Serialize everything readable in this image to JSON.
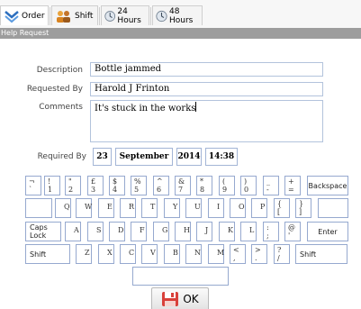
{
  "tabs": [
    {
      "label": "Order",
      "icon": "order-icon",
      "active": true
    },
    {
      "label": "Shift",
      "icon": "shift-icon"
    },
    {
      "label": "24 Hours",
      "icon": "clock-icon"
    },
    {
      "label": "48 Hours",
      "icon": "clock-icon"
    }
  ],
  "form_title": "Help Request",
  "form": {
    "description_label": "Description",
    "description_value": "Bottle jammed",
    "requested_by_label": "Requested By",
    "requested_by_value": "Harold J Frinton",
    "comments_label": "Comments",
    "comments_value": "It's stuck in the works",
    "required_by_label": "Required By",
    "required_by": {
      "day": "23",
      "month": "September",
      "year": "2014",
      "time": "14:38"
    }
  },
  "keyboard": {
    "row1": [
      [
        "¬",
        "`"
      ],
      [
        "!",
        "1"
      ],
      [
        "\"",
        "2"
      ],
      [
        "£",
        "3"
      ],
      [
        "$",
        "4"
      ],
      [
        "%",
        "5"
      ],
      [
        "^",
        "6"
      ],
      [
        "&",
        "7"
      ],
      [
        "*",
        "8"
      ],
      [
        "(",
        "9"
      ],
      [
        ")",
        "0"
      ],
      [
        "_",
        "-"
      ],
      [
        "+",
        "="
      ]
    ],
    "backspace": "Backspace",
    "row2": [
      "Q",
      "W",
      "E",
      "R",
      "T",
      "Y",
      "U",
      "I",
      "O",
      "P"
    ],
    "row2_brackets": [
      [
        "{",
        "["
      ],
      [
        "}",
        "]"
      ]
    ],
    "caps_lock": "Caps Lock",
    "row3": [
      "A",
      "S",
      "D",
      "F",
      "G",
      "H",
      "J",
      "K"
    ],
    "row3_extra": [
      [
        "L",
        ""
      ],
      [
        ":",
        ";"
      ],
      [
        "@",
        "'"
      ]
    ],
    "enter": "Enter",
    "shift_label": "Shift",
    "row4": [
      "Z",
      "X",
      "C",
      "V",
      "B",
      "N",
      "M"
    ],
    "row4_extra": [
      [
        "<",
        ","
      ],
      [
        ">",
        "."
      ],
      [
        "?",
        "/"
      ]
    ]
  },
  "ok_label": "OK",
  "colors": {
    "titlebar": "#9d9d9d",
    "key_border": "#96a9cf",
    "field_border": "#b3c3dc"
  }
}
